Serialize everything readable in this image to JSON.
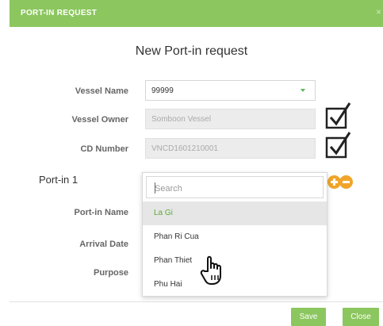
{
  "dialog": {
    "header_title": "PORT-IN REQUEST",
    "close_glyph": "×",
    "form_title": "New Port-in request"
  },
  "fields": {
    "vessel_name": {
      "label": "Vessel Name",
      "value": "99999"
    },
    "vessel_owner": {
      "label": "Vessel Owner",
      "value": "Somboon Vessel"
    },
    "cd_number": {
      "label": "CD Number",
      "value": "VNCD1601210001"
    }
  },
  "port_in": {
    "section_label": "Port-in 1",
    "port_in_name_label": "Port-in Name",
    "arrival_date_label": "Arrival Date",
    "purpose_label": "Purpose"
  },
  "dropdown": {
    "search_placeholder": "Search",
    "options": [
      "La Gi",
      "Phan Ri Cua",
      "Phan Thiet",
      "Phu Hai"
    ],
    "selected": "La Gi"
  },
  "buttons": {
    "save": "Save",
    "close": "Close"
  },
  "colors": {
    "header": "#8cc65f",
    "accent_orange": "#f0a52a",
    "selected_text": "#5aab35"
  },
  "icons": [
    "checkbox-checked-icon",
    "add-circle-icon",
    "remove-circle-icon",
    "hand-pointer-icon",
    "dropdown-caret-icon"
  ]
}
